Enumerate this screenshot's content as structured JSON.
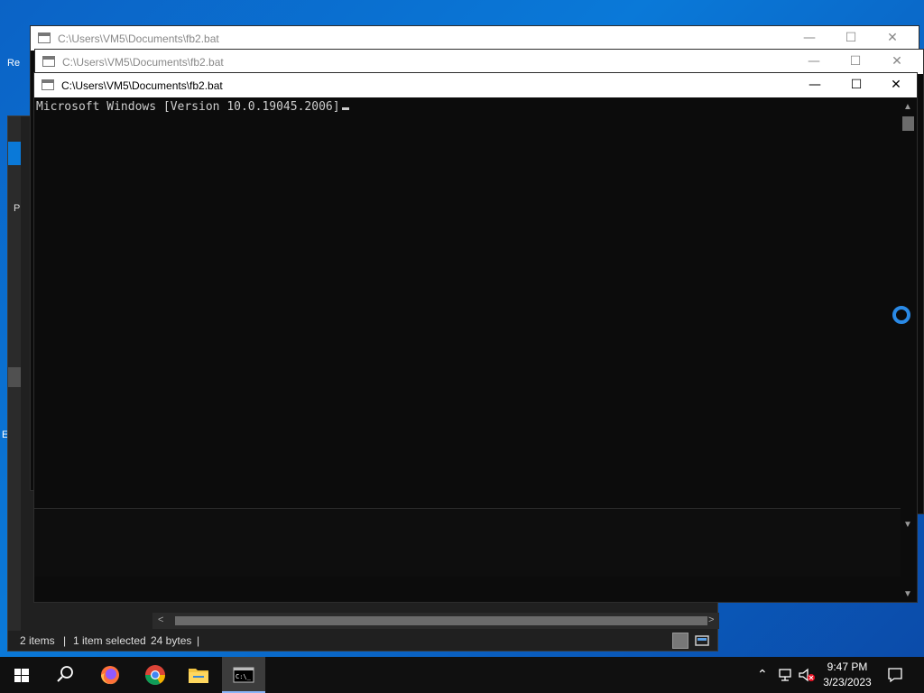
{
  "desktop": {
    "fragments": [
      "Re",
      "E"
    ]
  },
  "explorer": {
    "status_items": "2 items",
    "status_selected": "1 item selected",
    "status_size": "24 bytes",
    "left_fragments": [
      "P"
    ]
  },
  "cmd_windows": [
    {
      "title": "C:\\Users\\VM5\\Documents\\fb2.bat",
      "state": "inactive"
    },
    {
      "title": "C:\\Users\\VM5\\Documents\\fb2.bat",
      "state": "inactive"
    },
    {
      "title": "C:\\Users\\VM5\\Documents\\fb2.bat",
      "state": "active"
    }
  ],
  "console": {
    "line1": "Microsoft Windows [Version 10.0.19045.2006]"
  },
  "window_controls": {
    "minimize": "—",
    "maximize": "☐",
    "close": "✕"
  },
  "taskbar": {
    "apps": [
      "start-icon",
      "search-icon",
      "firefox-icon",
      "chrome-icon",
      "file-explorer-icon",
      "command-prompt-icon"
    ],
    "time": "9:47 PM",
    "date": "3/23/2023"
  },
  "colors": {
    "accent": "#0a79d8",
    "console_bg": "#0c0c0c",
    "console_text": "#cccccc"
  }
}
